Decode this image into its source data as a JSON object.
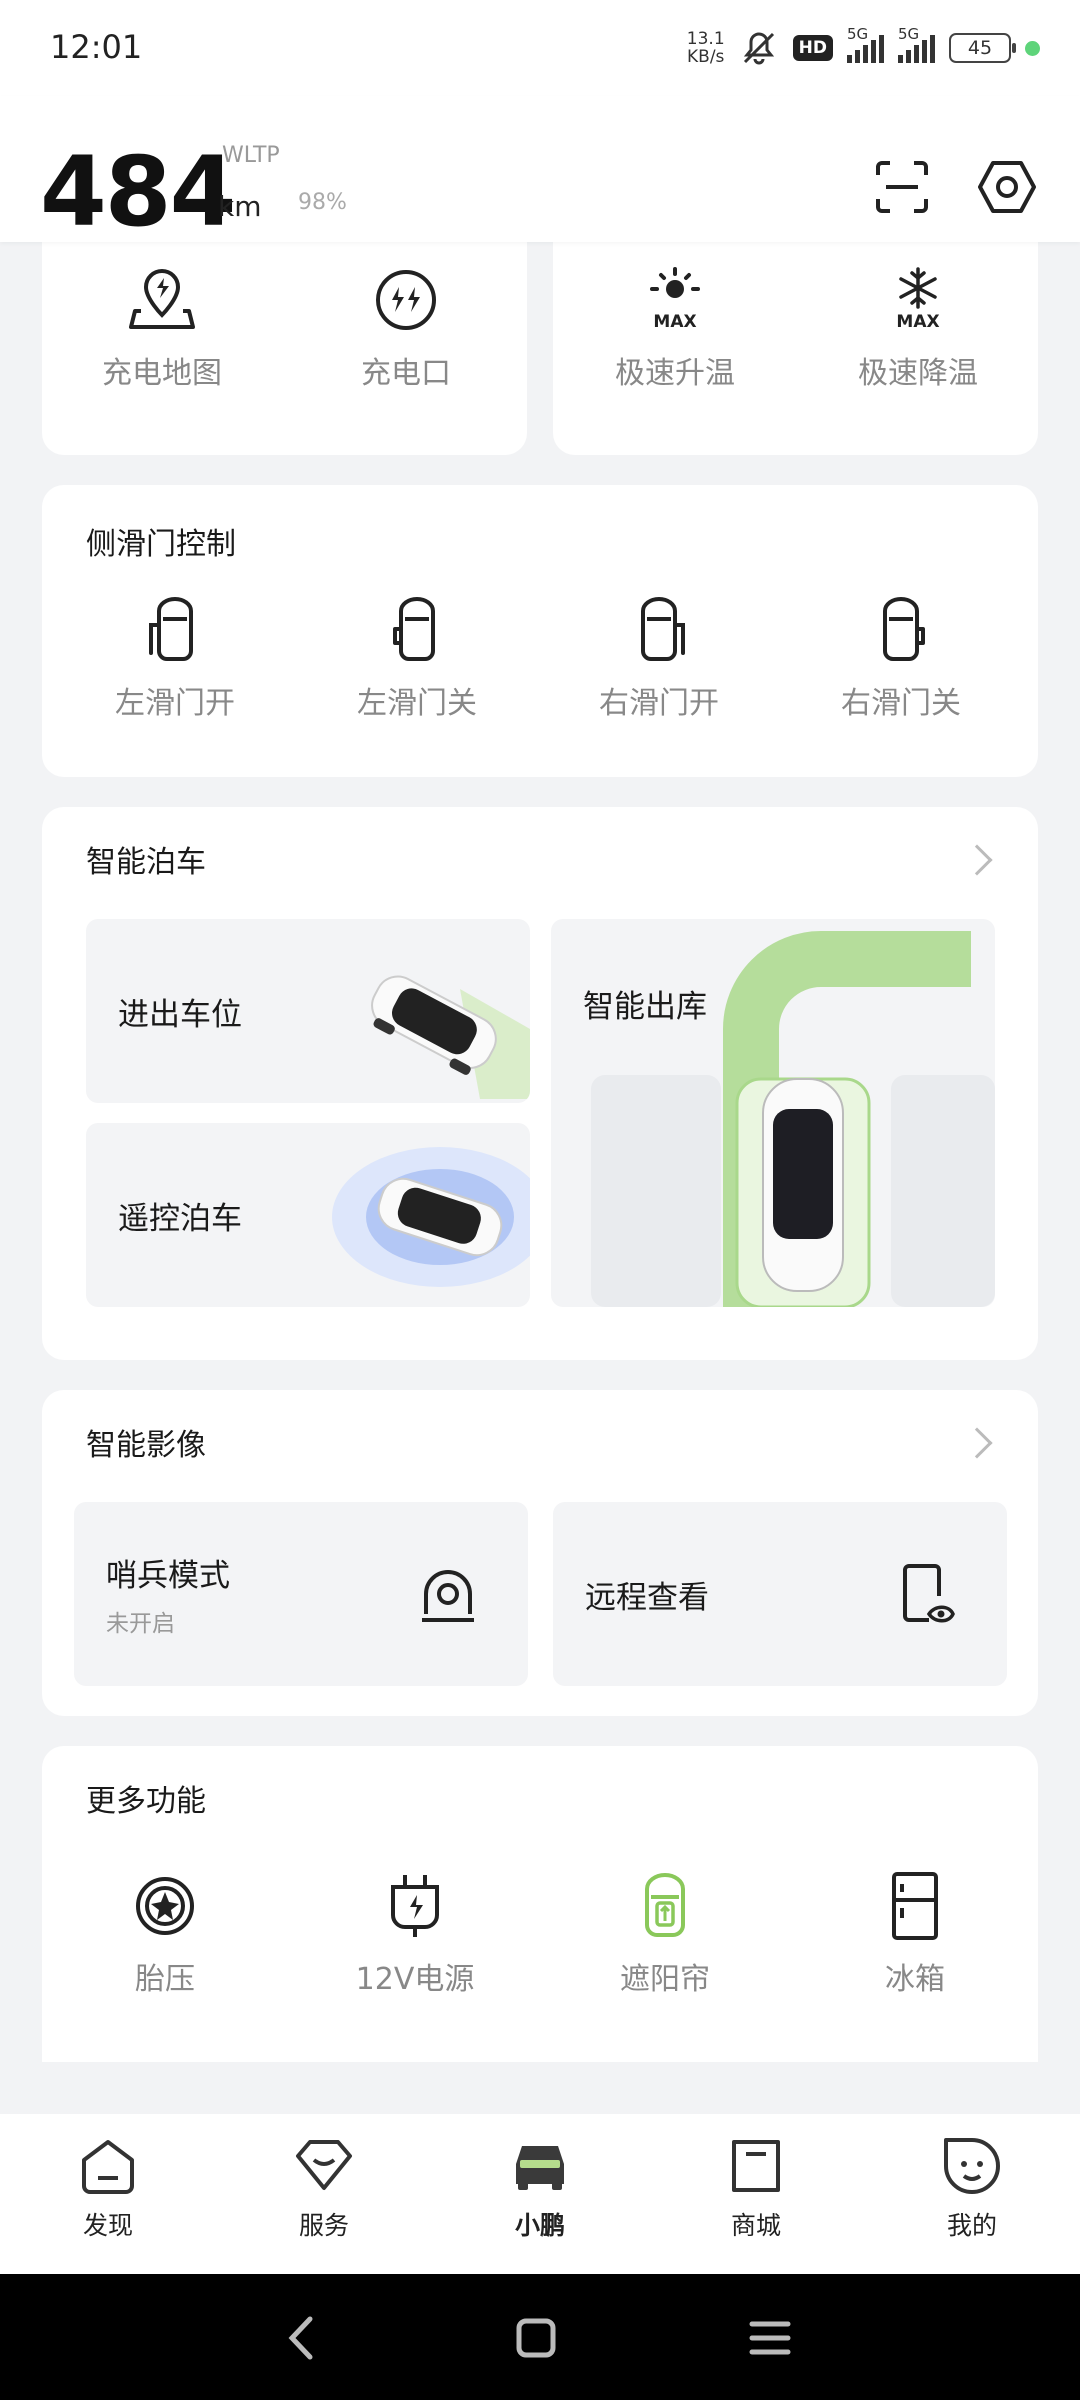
{
  "status": {
    "time": "12:01",
    "net_speed_value": "13.1",
    "net_speed_unit": "KB/s",
    "hd_label": "HD",
    "sim1_label": "5G",
    "sim2_label": "5G",
    "battery": "45"
  },
  "header": {
    "range_value": "484",
    "range_unit": "km",
    "range_standard": "WLTP",
    "battery_percent": "98%"
  },
  "quick_left": [
    {
      "label": "充电地图",
      "icon": "charging-map-icon"
    },
    {
      "label": "充电口",
      "icon": "charging-port-icon"
    }
  ],
  "quick_right": [
    {
      "label": "极速升温",
      "icon": "max-heat-icon"
    },
    {
      "label": "极速降温",
      "icon": "max-cool-icon"
    }
  ],
  "icon_text": {
    "max": "MAX"
  },
  "sliding_door": {
    "title": "侧滑门控制",
    "items": [
      {
        "label": "左滑门开",
        "icon": "left-door-open-icon"
      },
      {
        "label": "左滑门关",
        "icon": "left-door-close-icon"
      },
      {
        "label": "右滑门开",
        "icon": "right-door-open-icon"
      },
      {
        "label": "右滑门关",
        "icon": "right-door-close-icon"
      }
    ]
  },
  "parking": {
    "title": "智能泊车",
    "tiles": [
      "进出车位",
      "遥控泊车",
      "智能出库"
    ]
  },
  "imaging": {
    "title": "智能影像",
    "sentry_label": "哨兵模式",
    "sentry_status": "未开启",
    "remote_view_label": "远程查看"
  },
  "more": {
    "title": "更多功能",
    "items": [
      {
        "label": "胎压",
        "icon": "tire-pressure-icon"
      },
      {
        "label": "12V电源",
        "icon": "power-plug-icon"
      },
      {
        "label": "遮阳帘",
        "icon": "sunshade-icon"
      },
      {
        "label": "冰箱",
        "icon": "fridge-icon"
      }
    ]
  },
  "tabs": [
    {
      "label": "发现",
      "icon": "discover-icon"
    },
    {
      "label": "服务",
      "icon": "service-icon"
    },
    {
      "label": "小鹏",
      "icon": "car-icon"
    },
    {
      "label": "商城",
      "icon": "store-icon"
    },
    {
      "label": "我的",
      "icon": "profile-icon"
    }
  ],
  "colors": {
    "accent": "#8ac85a",
    "active_tab": "#1a1a1a"
  }
}
